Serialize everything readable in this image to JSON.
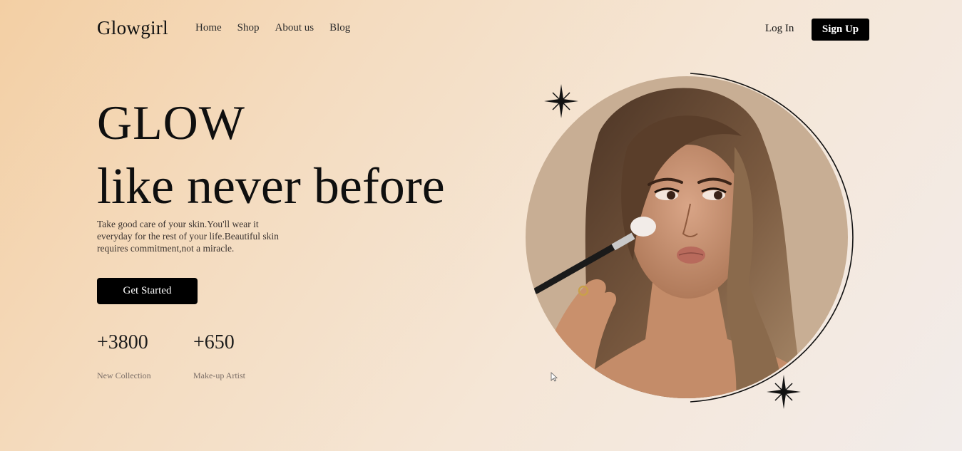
{
  "brand": {
    "logo": "Glowgirl"
  },
  "nav": {
    "links": [
      "Home",
      "Shop",
      "About us",
      "Blog"
    ],
    "login_label": "Log In",
    "signup_label": "Sign Up"
  },
  "hero": {
    "title_line1": "GLOW",
    "title_line2": "like never before",
    "description": "Take good care of your skin.You'll wear it everyday for the rest of your life.Beautiful skin requires commitment,not a miracle.",
    "cta_label": "Get Started"
  },
  "stats": [
    {
      "value": "+3800",
      "label": "New Collection"
    },
    {
      "value": "+650",
      "label": "Make-up Artist"
    }
  ],
  "icons": {
    "sparkle": "sparkle-icon",
    "cursor": "mouse-cursor-icon"
  },
  "colors": {
    "accent": "#000000",
    "background_start": "#f3cfa4",
    "background_end": "#f2ecea",
    "photo_backdrop": "#c8ae94"
  }
}
